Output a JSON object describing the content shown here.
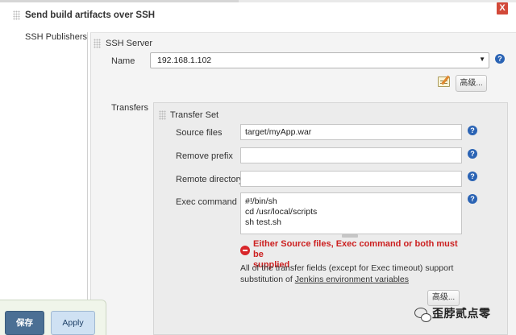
{
  "section": {
    "title": "Send build artifacts over SSH",
    "close_label": "X",
    "publishers_label": "SSH Publishers"
  },
  "server": {
    "title": "SSH Server",
    "name_label": "Name",
    "name_value": "192.168.1.102",
    "advanced_label": "高级..."
  },
  "transfers": {
    "label": "Transfers",
    "set_title": "Transfer Set",
    "source_files_label": "Source files",
    "source_files_value": "target/myApp.war",
    "remove_prefix_label": "Remove prefix",
    "remove_prefix_value": "",
    "remote_directory_label": "Remote directory",
    "remote_directory_value": "",
    "exec_command_label": "Exec command",
    "exec_command_lines": [
      "#!/bin/sh",
      "cd /usr/local/scripts",
      "sh test.sh"
    ],
    "error_line1": "Either Source files, Exec command or both must be",
    "error_line2": "supplied",
    "info_line1": "All of the transfer fields (except for Exec timeout) support",
    "info_prefix": "substitution of ",
    "info_link": "Jenkins environment variables",
    "advanced_label": "高级..."
  },
  "footer": {
    "save_label": "保存",
    "apply_label": "Apply"
  },
  "watermark": {
    "text": "歪脖贰点零"
  },
  "icons": {
    "help": "help-icon",
    "error": "error-icon",
    "notepad": "notepad-icon",
    "wechat": "wechat-icon"
  },
  "colors": {
    "help_icon": "#2a63b4",
    "error_text": "#cc2020",
    "save_button": "#4b6f94",
    "apply_button": "#cfe1f3",
    "close_button": "#d24939"
  }
}
